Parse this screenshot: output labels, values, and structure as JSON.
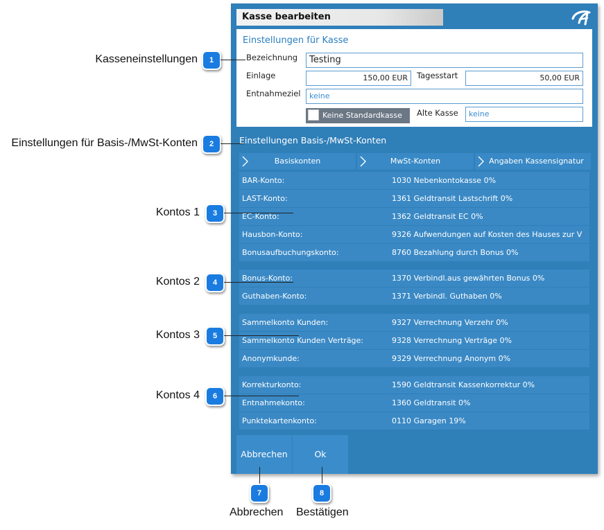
{
  "dialog": {
    "title": "Kasse bearbeiten",
    "logo_icon": "app-logo-icon",
    "settings": {
      "title": "Einstellungen für Kasse",
      "bezeichnung_label": "Bezeichnung",
      "bezeichnung_value": "Testing",
      "einlage_label": "Einlage",
      "einlage_value": "150,00 EUR",
      "tagesstart_label": "Tagesstart",
      "tagesstart_value": "50,00 EUR",
      "entnahmeziel_label": "Entnahmeziel",
      "entnahmeziel_value": "keine",
      "standard_label": "Keine Standardkasse",
      "alte_kasse_label": "Alte Kasse",
      "alte_kasse_value": "keine"
    },
    "konten_title": "Einstellungen Basis-/MwSt-Konten",
    "tabs": [
      "Basiskonten",
      "MwSt-Konten",
      "Angaben Kassensignatur"
    ],
    "groups": [
      [
        {
          "label": "BAR-Konto:",
          "value": "1030 Nebenkontokasse 0%"
        },
        {
          "label": "LAST-Konto:",
          "value": "1361 Geldtransit Lastschrift 0%"
        },
        {
          "label": "EC-Konto:",
          "value": "1362 Geldtransit EC 0%"
        },
        {
          "label": "Hausbon-Konto:",
          "value": "9326 Aufwendungen auf Kosten des Hauses zur V"
        },
        {
          "label": "Bonusaufbuchungskonto:",
          "value": "8760 Bezahlung durch Bonus 0%"
        }
      ],
      [
        {
          "label": "Bonus-Konto:",
          "value": "1370 Verbindl.aus gewährten Bonus 0%"
        },
        {
          "label": "Guthaben-Konto:",
          "value": "1371 Verbindl. Guthaben 0%"
        }
      ],
      [
        {
          "label": "Sammelkonto Kunden:",
          "value": "9327 Verrechnung Verzehr 0%"
        },
        {
          "label": "Sammelkonto Kunden Verträge:",
          "value": "9328 Verrechnung Verträge 0%"
        },
        {
          "label": "Anonymkunde:",
          "value": "9329 Verrechnung Anonym 0%"
        }
      ],
      [
        {
          "label": "Korrekturkonto:",
          "value": "1590 Geldtransit Kassenkorrektur 0%"
        },
        {
          "label": "Entnahmekonto:",
          "value": "1360 Geldtransit 0%"
        },
        {
          "label": "Punktekartenkonto:",
          "value": "0110 Garagen 19%"
        }
      ]
    ],
    "buttons": {
      "cancel": "Abbrechen",
      "ok": "Ok"
    }
  },
  "annotations": {
    "left": [
      {
        "num": "1",
        "text": "Kasseneinstellungen"
      },
      {
        "num": "2",
        "text": "Einstellungen für Basis-/MwSt-Konten"
      },
      {
        "num": "3",
        "text": "Kontos 1"
      },
      {
        "num": "4",
        "text": "Kontos 2"
      },
      {
        "num": "5",
        "text": "Kontos 3"
      },
      {
        "num": "6",
        "text": "Kontos 4"
      }
    ],
    "bottom": [
      {
        "num": "7",
        "text": "Abbrechen"
      },
      {
        "num": "8",
        "text": "Bestätigen"
      }
    ]
  },
  "colors": {
    "dialog_bg": "#2f7fb9",
    "row_bg": "#3a89c5",
    "badge": "#1a7ce0",
    "field_border": "#5a9bd0"
  }
}
